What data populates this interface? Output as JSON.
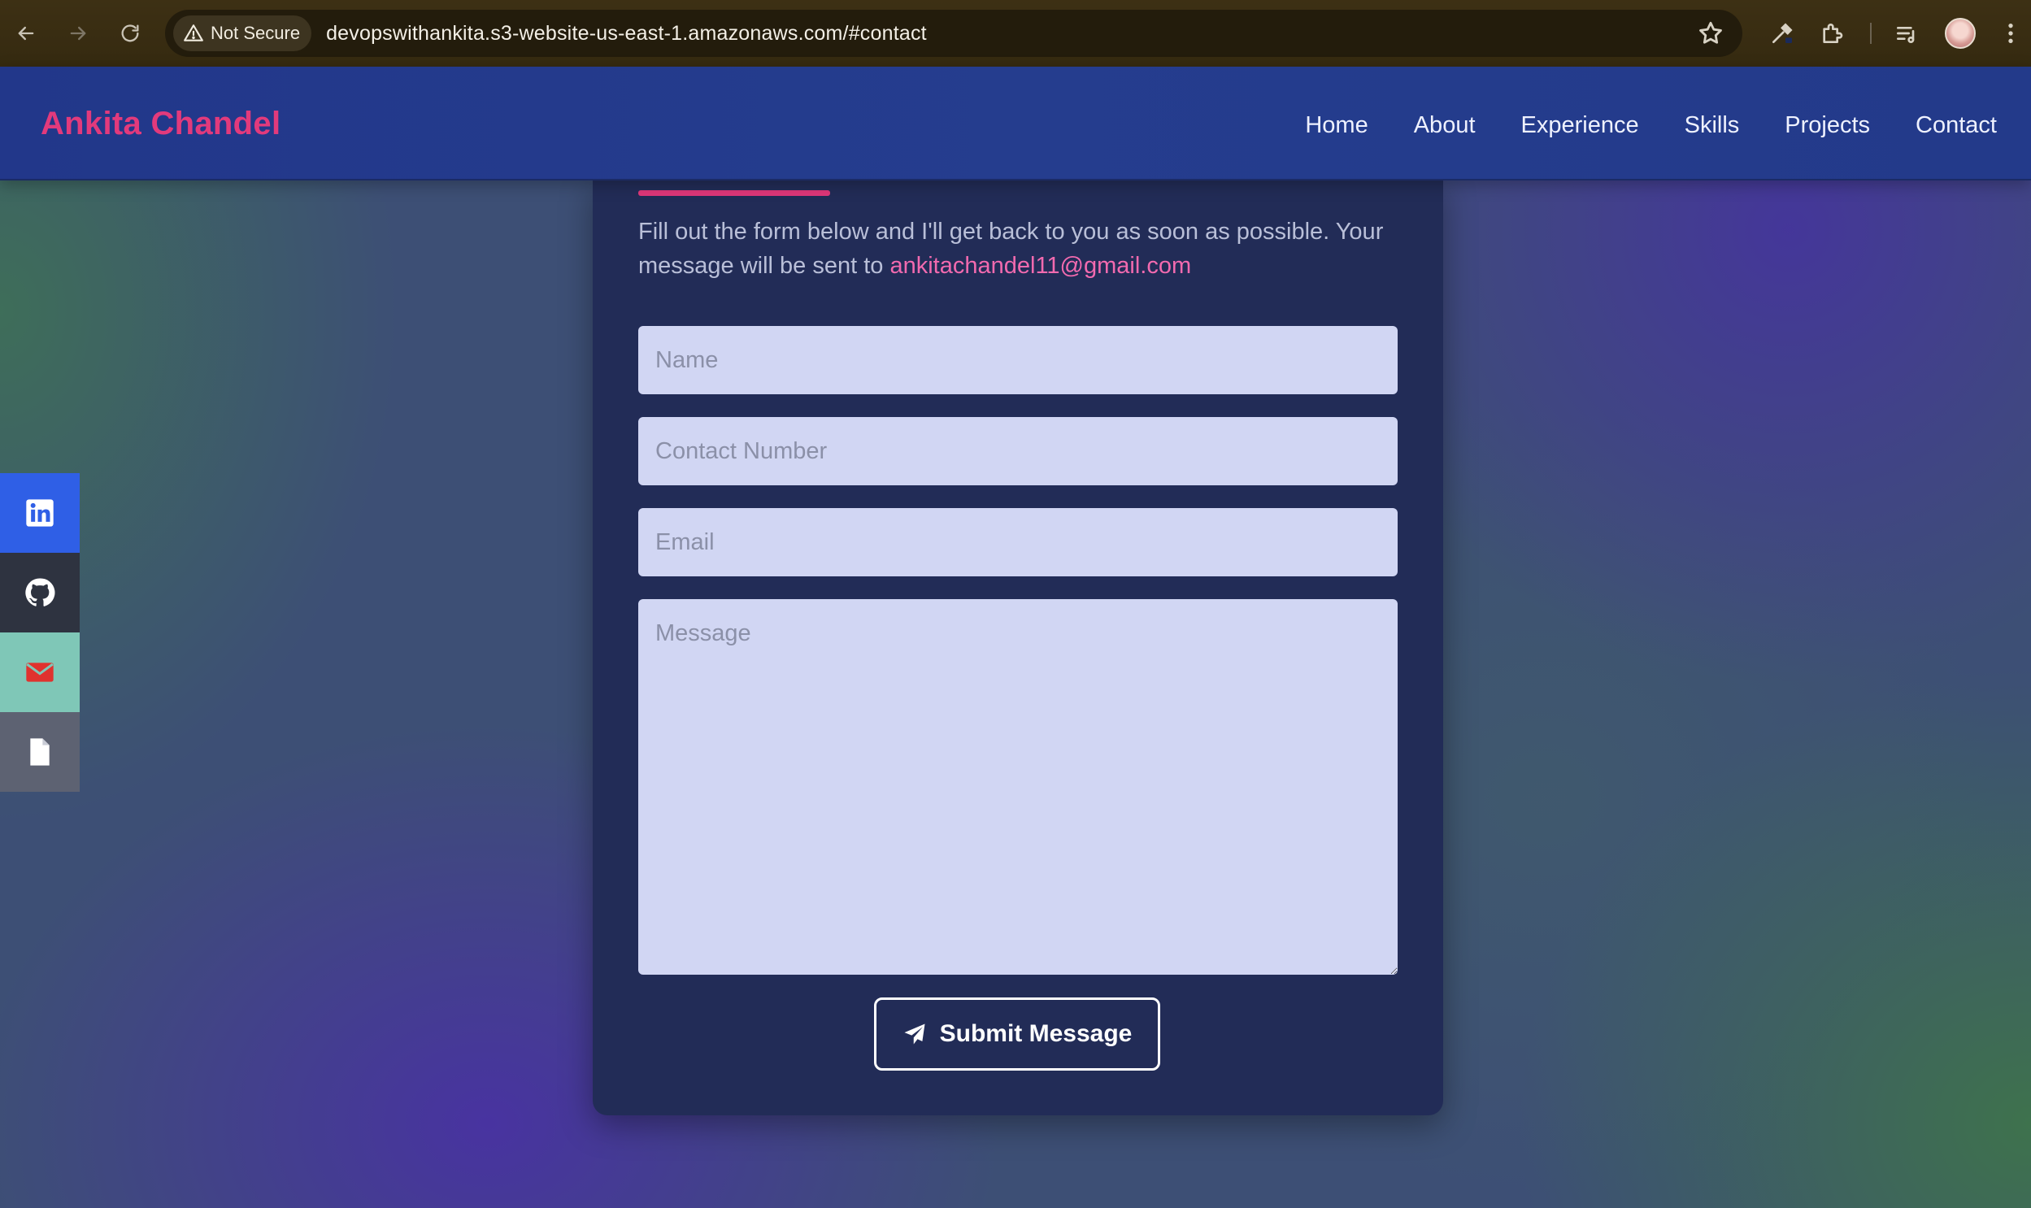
{
  "browser": {
    "security_label": "Not Secure",
    "url": "devopswithankita.s3-website-us-east-1.amazonaws.com/#contact",
    "icons": [
      "back-icon",
      "forward-icon",
      "reload-icon",
      "warning-icon",
      "star-icon",
      "eyedropper-icon",
      "extensions-icon",
      "reading-list-icon",
      "profile-avatar",
      "more-menu-icon"
    ]
  },
  "header": {
    "brand": "Ankita Chandel",
    "nav": [
      "Home",
      "About",
      "Experience",
      "Skills",
      "Projects",
      "Contact"
    ]
  },
  "social": {
    "items": [
      "linkedin-icon",
      "github-icon",
      "mail-icon",
      "document-icon"
    ],
    "colors": {
      "linkedin": "#2f5fe6",
      "github": "#2e3340",
      "mail": "#7fc7b7",
      "doc": "#5d6272"
    }
  },
  "contact": {
    "intro_text": "Fill out the form below and I'll get back to you as soon as possible. Your message will be sent to ",
    "email": "ankitachandel11@gmail.com",
    "fields": {
      "name_placeholder": "Name",
      "phone_placeholder": "Contact Number",
      "email_placeholder": "Email",
      "message_placeholder": "Message"
    },
    "submit_label": "Submit Message"
  },
  "colors": {
    "brand": "#e23a7c",
    "header_bg": "#253d8e",
    "card_bg": "#222c57",
    "accent": "#e0377a",
    "input_bg": "#d1d6f3",
    "link": "#f26aaf"
  }
}
